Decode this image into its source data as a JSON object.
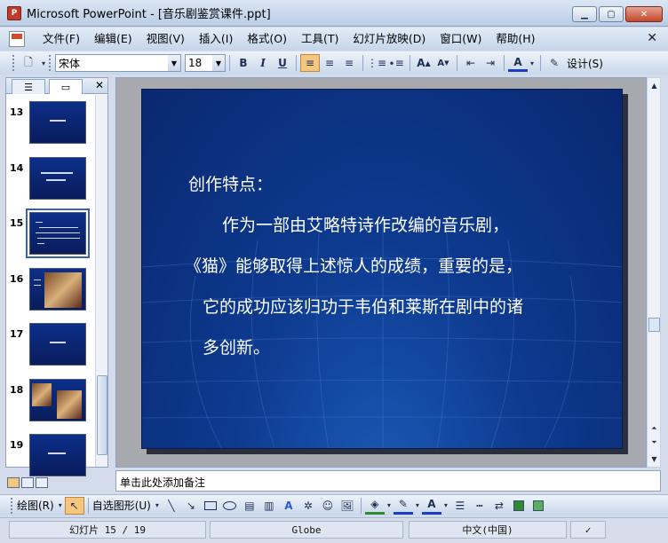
{
  "window": {
    "title": "Microsoft PowerPoint - [音乐剧鉴赏课件.ppt]",
    "app_icon": "P"
  },
  "menubar": {
    "items": [
      "文件(F)",
      "编辑(E)",
      "视图(V)",
      "插入(I)",
      "格式(O)",
      "工具(T)",
      "幻灯片放映(D)",
      "窗口(W)",
      "帮助(H)"
    ]
  },
  "format_toolbar": {
    "font_name": "宋体",
    "font_size": "18",
    "design_label": "设计(S)",
    "bold": "B",
    "italic": "I",
    "underline": "U"
  },
  "slides_panel": {
    "thumbnails": [
      {
        "number": "13",
        "type": "title"
      },
      {
        "number": "14",
        "type": "lines"
      },
      {
        "number": "15",
        "type": "text",
        "selected": true
      },
      {
        "number": "16",
        "type": "image"
      },
      {
        "number": "17",
        "type": "title"
      },
      {
        "number": "18",
        "type": "image"
      },
      {
        "number": "19",
        "type": "title"
      }
    ]
  },
  "slide": {
    "lines": [
      "创作特点：",
      "作为一部由艾略特诗作改编的音乐剧，",
      "《猫》能够取得上述惊人的成绩，重要的是，",
      "它的成功应该归功于韦伯和莱斯在剧中的诸",
      "多创新。"
    ]
  },
  "notes": {
    "placeholder": "单击此处添加备注"
  },
  "draw_toolbar": {
    "draw_label": "绘图(R)",
    "autoshapes_label": "自选图形(U)"
  },
  "statusbar": {
    "slide_pos": "幻灯片 15 / 19",
    "template": "Globe",
    "language": "中文(中国)"
  },
  "colors": {
    "slide_bg": "#0d3a8f",
    "accent_active": "#f5c77e"
  }
}
